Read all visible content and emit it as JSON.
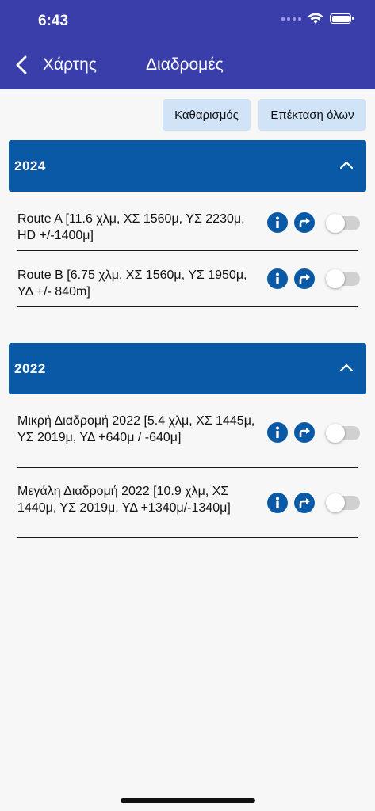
{
  "status_bar": {
    "time": "6:43"
  },
  "nav": {
    "back_label": "Χάρτης",
    "title": "Διαδρομές"
  },
  "actions": {
    "clear_label": "Καθαρισμός",
    "expand_label": "Επέκταση όλων"
  },
  "colors": {
    "header": "#3a3eab",
    "section": "#0a59a6",
    "button_bg": "#d1e3f7"
  },
  "sections": [
    {
      "year": "2024",
      "routes": [
        {
          "label": "Route A [11.6 χλμ, ΧΣ 1560μ, ΥΣ 2230μ, HD +/-1400μ]",
          "enabled": false
        },
        {
          "label": "Route B [6.75 χλμ, ΧΣ 1560μ, ΥΣ 1950μ, ΥΔ +/- 840m]",
          "enabled": false
        }
      ]
    },
    {
      "year": "2022",
      "routes": [
        {
          "label": "Μικρή Διαδρομή 2022 [5.4 χλμ, ΧΣ 1445μ, ΥΣ 2019μ, ΥΔ +640μ / -640μ]",
          "enabled": false
        },
        {
          "label": "Μεγάλη Διαδρομή 2022  [10.9 χλμ, ΧΣ 1440μ, ΥΣ 2019μ, ΥΔ +1340μ/-1340μ]",
          "enabled": false
        }
      ]
    }
  ],
  "icons": [
    "chevron-left-icon",
    "chevron-up-icon",
    "info-icon",
    "directions-icon",
    "wifi-icon",
    "battery-icon"
  ]
}
